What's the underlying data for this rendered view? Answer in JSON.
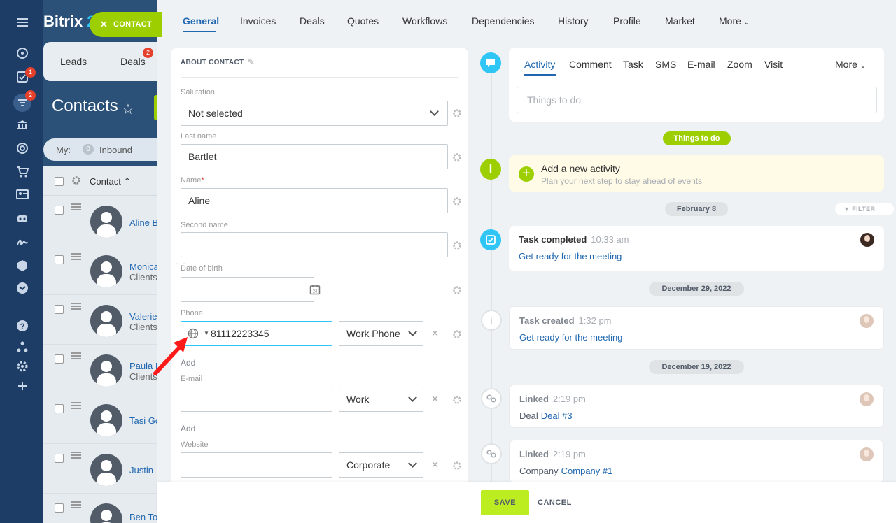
{
  "app": {
    "logo_text": "Bitrix",
    "logo_num": "2",
    "contact_badge": "CONTACT"
  },
  "leftnav": {
    "badges": [
      "1",
      "2"
    ]
  },
  "background_page": {
    "tabs": [
      "Leads",
      "Deals"
    ],
    "deals_badge": "2",
    "title": "Contacts",
    "filter_my": "My:",
    "filter_count": "0",
    "filter_inbound": "Inbound",
    "column_header": "Contact",
    "rows": [
      {
        "name": "Aline B",
        "sub": ""
      },
      {
        "name": "Monica",
        "sub": "Clients"
      },
      {
        "name": "Valerie",
        "sub": "Clients"
      },
      {
        "name": "Paula I",
        "sub": "Clients"
      },
      {
        "name": "Tasi Go",
        "sub": ""
      },
      {
        "name": "Justin",
        "sub": ""
      },
      {
        "name": "Ben To",
        "sub": ""
      }
    ]
  },
  "card_tabs": [
    "General",
    "Invoices",
    "Deals",
    "Quotes",
    "Workflows",
    "Dependencies",
    "History",
    "Profile",
    "Market",
    "More"
  ],
  "form": {
    "section_title": "ABOUT CONTACT",
    "salutation": {
      "label": "Salutation",
      "value": "Not selected"
    },
    "last_name": {
      "label": "Last name",
      "value": "Bartlet"
    },
    "name": {
      "label": "Name",
      "required_mark": "*",
      "value": "Aline"
    },
    "second_name": {
      "label": "Second name",
      "value": ""
    },
    "dob": {
      "label": "Date of birth",
      "value": "",
      "calendar_day": "24"
    },
    "phone": {
      "label": "Phone",
      "value": "81112223345",
      "type": "Work Phone",
      "add": "Add"
    },
    "email": {
      "label": "E-mail",
      "value": "",
      "type": "Work",
      "add": "Add"
    },
    "website": {
      "label": "Website",
      "value": "",
      "type": "Corporate"
    }
  },
  "activity": {
    "tabs": [
      "Activity",
      "Comment",
      "Task",
      "SMS",
      "E-mail",
      "Zoom",
      "Visit",
      "More"
    ],
    "placeholder": "Things to do",
    "things_pill": "Things to do",
    "add_title": "Add a new activity",
    "add_sub": "Plan your next step to stay ahead of events",
    "filter": "FILTER",
    "dates": [
      "February 8",
      "December 29, 2022",
      "December 19, 2022"
    ],
    "events": [
      {
        "title": "Task completed",
        "time": "10:33 am",
        "prefix": "",
        "link": "Get ready for the meeting"
      },
      {
        "title": "Task created",
        "time": "1:32 pm",
        "prefix": "",
        "link": "Get ready for the meeting"
      },
      {
        "title": "Linked",
        "time": "2:19 pm",
        "prefix": "Deal",
        "link": "Deal #3"
      },
      {
        "title": "Linked",
        "time": "2:19 pm",
        "prefix": "Company",
        "link": "Company #1"
      }
    ]
  },
  "footer": {
    "save": "SAVE",
    "cancel": "CANCEL"
  },
  "colors": {
    "accent_blue": "#2067b0",
    "green": "#9dcf00",
    "save_green": "#bbed21",
    "nav_bg": "#1d3d66",
    "arrow_red": "#ff1a1a"
  }
}
